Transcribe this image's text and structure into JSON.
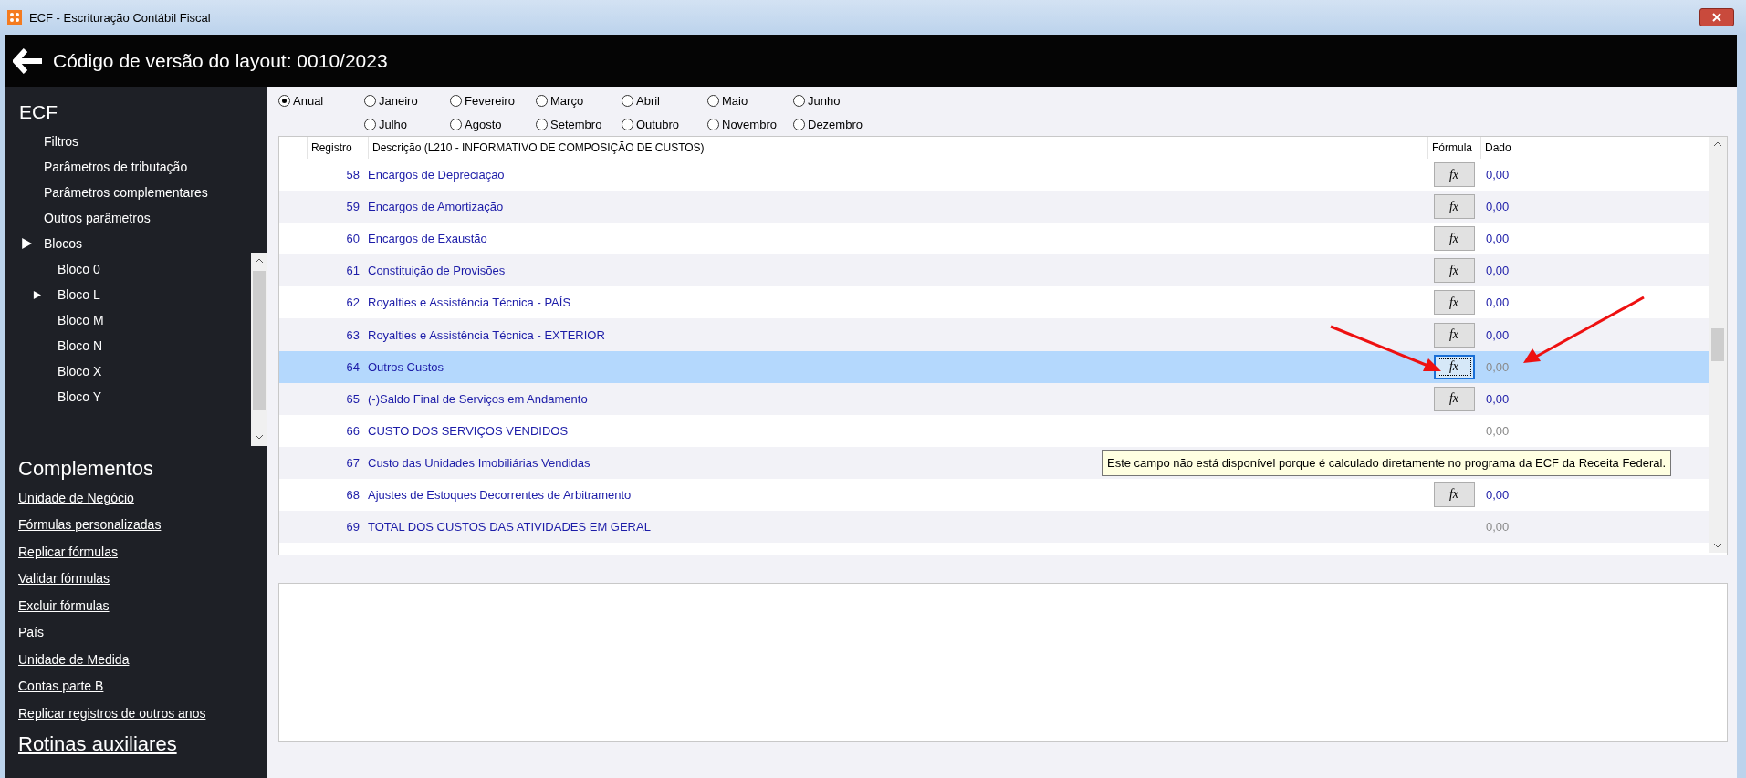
{
  "window": {
    "title": "ECF - Escrituração Contábil Fiscal"
  },
  "header": {
    "title": "Código de versão do layout: 0010/2023"
  },
  "sidebar": {
    "title": "ECF",
    "items": [
      {
        "label": "Filtros",
        "expandable": false
      },
      {
        "label": "Parâmetros de tributação",
        "expandable": false
      },
      {
        "label": "Parâmetros complementares",
        "expandable": false
      },
      {
        "label": "Outros parâmetros",
        "expandable": false
      },
      {
        "label": "Blocos",
        "expandable": true,
        "children": [
          {
            "label": "Bloco 0",
            "expandable": false
          },
          {
            "label": "Bloco L",
            "expandable": true
          },
          {
            "label": "Bloco M",
            "expandable": false
          },
          {
            "label": "Bloco N",
            "expandable": false
          },
          {
            "label": "Bloco X",
            "expandable": false
          },
          {
            "label": "Bloco Y",
            "expandable": false
          }
        ]
      }
    ]
  },
  "complementos": {
    "title": "Complementos",
    "links": [
      "Unidade de Negócio",
      "Fórmulas personalizadas",
      "Replicar fórmulas",
      "Validar fórmulas",
      "Excluir fórmulas",
      "País",
      "Unidade de Medida",
      "Contas parte B",
      "Replicar registros de outros anos"
    ]
  },
  "rotinas": {
    "title": "Rotinas auxiliares"
  },
  "periods": [
    {
      "label": "Anual",
      "selected": true
    },
    {
      "label": "Janeiro",
      "selected": false
    },
    {
      "label": "Fevereiro",
      "selected": false
    },
    {
      "label": "Março",
      "selected": false
    },
    {
      "label": "Abril",
      "selected": false
    },
    {
      "label": "Maio",
      "selected": false
    },
    {
      "label": "Junho",
      "selected": false
    },
    {
      "label": "Julho",
      "selected": false
    },
    {
      "label": "Agosto",
      "selected": false
    },
    {
      "label": "Setembro",
      "selected": false
    },
    {
      "label": "Outubro",
      "selected": false
    },
    {
      "label": "Novembro",
      "selected": false
    },
    {
      "label": "Dezembro",
      "selected": false
    }
  ],
  "table": {
    "columns": [
      "Registro",
      "Descrição (L210 - INFORMATIVO DE COMPOSIÇÃO DE CUSTOS)",
      "Fórmula",
      "Dado"
    ],
    "rows": [
      {
        "registro": "58",
        "descricao": "Encargos de Depreciação",
        "formula": "fx",
        "formula_focused": false,
        "dado": "0,00",
        "dado_disabled": false,
        "selected": false
      },
      {
        "registro": "59",
        "descricao": "Encargos de Amortização",
        "formula": "fx",
        "formula_focused": false,
        "dado": "0,00",
        "dado_disabled": false,
        "selected": false
      },
      {
        "registro": "60",
        "descricao": "Encargos de Exaustão",
        "formula": "fx",
        "formula_focused": false,
        "dado": "0,00",
        "dado_disabled": false,
        "selected": false
      },
      {
        "registro": "61",
        "descricao": "Constituição de Provisões",
        "formula": "fx",
        "formula_focused": false,
        "dado": "0,00",
        "dado_disabled": false,
        "selected": false
      },
      {
        "registro": "62",
        "descricao": "Royalties e Assistência Técnica - PAÍS",
        "formula": "fx",
        "formula_focused": false,
        "dado": "0,00",
        "dado_disabled": false,
        "selected": false
      },
      {
        "registro": "63",
        "descricao": "Royalties e Assistência Técnica - EXTERIOR",
        "formula": "fx",
        "formula_focused": false,
        "dado": "0,00",
        "dado_disabled": false,
        "selected": false
      },
      {
        "registro": "64",
        "descricao": "Outros Custos",
        "formula": "fx",
        "formula_focused": true,
        "dado": "0,00",
        "dado_disabled": true,
        "selected": true
      },
      {
        "registro": "65",
        "descricao": "(-)Saldo Final de Serviços em Andamento",
        "formula": "fx",
        "formula_focused": false,
        "dado": "0,00",
        "dado_disabled": false,
        "selected": false
      },
      {
        "registro": "66",
        "descricao": "CUSTO DOS SERVIÇOS VENDIDOS",
        "dado": "0,00",
        "dado_disabled": true,
        "selected": false
      },
      {
        "registro": "67",
        "descricao": "Custo das Unidades Imobiliárias Vendidas",
        "selected": false
      },
      {
        "registro": "68",
        "descricao": "Ajustes de Estoques Decorrentes de Arbitramento",
        "formula": "fx",
        "formula_focused": false,
        "dado": "0,00",
        "dado_disabled": false,
        "selected": false
      },
      {
        "registro": "69",
        "descricao": "TOTAL DOS CUSTOS DAS ATIVIDADES EM GERAL",
        "dado": "0,00",
        "dado_disabled": true,
        "selected": false
      }
    ]
  },
  "tooltip": {
    "text": "Este campo não está disponível porque é calculado diretamente no programa da ECF da Receita Federal."
  }
}
